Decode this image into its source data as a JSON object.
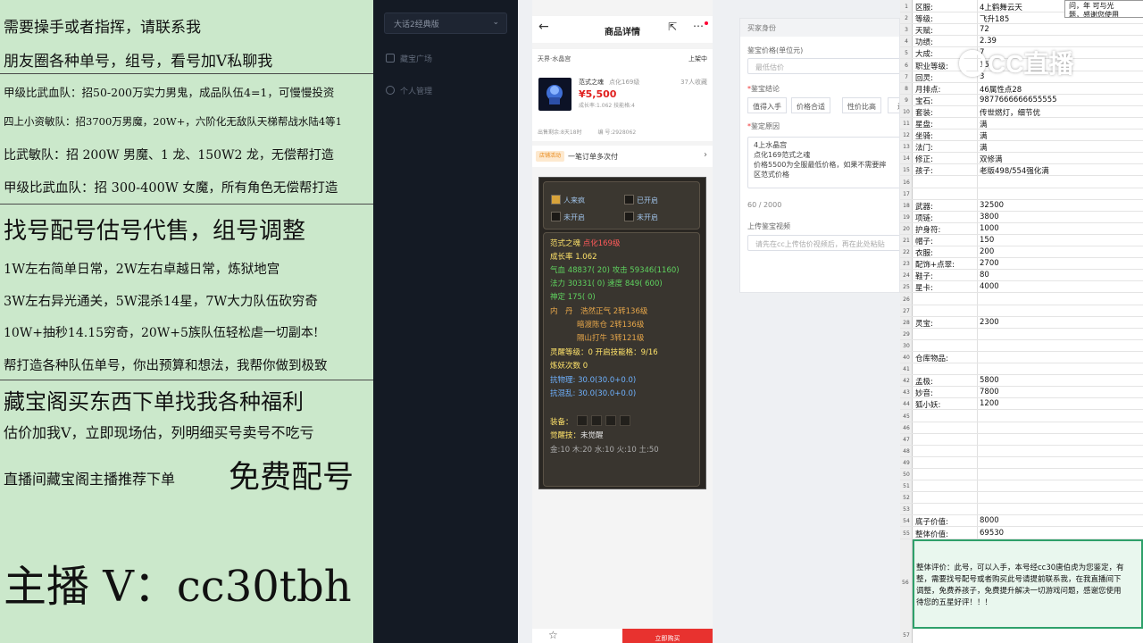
{
  "left_panel": {
    "lines": [
      "需要操手或者指挥，请联系我",
      "朋友圈各种单号，组号，看号加V私聊我",
      "甲级比武血队：招50-200万实力男鬼，成品队伍4=1，可慢慢投资",
      "四上小资敏队：招3700万男魔，20W+，六阶化无敌队天梯帮战水陆4等1",
      "比武敏队：招 200W 男魔、1 龙、150W2 龙，无偿帮打造",
      "甲级比武血队：招 300-400W 女魔，所有角色无偿帮打造",
      "找号配号估号代售，组号调整",
      "1W左右简单日常，2W左右卓越日常，炼狱地宫",
      "3W左右异光通关，5W混杀14星，7W大力队伍砍穷奇",
      "10W+抽秒14.15穷奇，20W+5族队伍轻松虐一切副本!",
      "帮打造各种队伍单号，你出预算和想法，我帮你做到极致",
      "藏宝阁买东西下单找我各种福利",
      "估价加我V，立即现场估，列明细买号卖号不吃亏",
      "直播间藏宝阁主播推荐下单",
      "免费配号",
      "主播 V：cc30tbh"
    ]
  },
  "sidebar": {
    "server_select": "大话2经典版",
    "items": [
      "藏宝广场",
      "个人管理"
    ]
  },
  "phone": {
    "header_title": "商品详情",
    "server": "天界·水晶宫",
    "status": "上架中",
    "product_name": "范式之魂",
    "product_level": "点化169级",
    "price": "¥5,500",
    "growth_line": "成长率:1.062  技能格:4",
    "favorites": "37人收藏",
    "remaining": "出售剩余:8天18时",
    "serial": "编 号:2928062",
    "promo_tag": "店铺活动",
    "promo_text": "一笔订单多次付",
    "buy_button": "立即购买",
    "game": {
      "slots": [
        "人来疯",
        "已开启",
        "未开启",
        "未开启"
      ],
      "name": "范式之魂",
      "name_level": "点化169级",
      "growth": "成长率 1.062",
      "hp": "气血 48837( 20) 攻击 59346(1160)",
      "mp": "法力 30331( 0) 速度 849( 600)",
      "focus": "神定 175( 0)",
      "inner1_label": "内　丹",
      "inner1": "浩然正气 2转136级",
      "inner2": "暗渡陈仓 2转136级",
      "inner3": "隔山打牛 3转121级",
      "spirit": "灵醒等级：0 开启技能格：9/16",
      "refine": "炼妖次数 0",
      "res1": "抗物理: 30.0(30.0+0.0)",
      "res2": "抗混乱: 30.0(30.0+0.0)",
      "equip_label": "装备：",
      "awake_label": "觉醒技：",
      "awake_value": "未觉醒",
      "elements": "金:10 木:20 水:10 火:10 土:50"
    }
  },
  "form": {
    "role_label": "买家身份",
    "appraise_price_label": "鉴宝价格(单位元)",
    "appraise_price_placeholder": "最低估价",
    "conclusion_label": "鉴宝结论",
    "conclusion_options": [
      "值得入手",
      "价格合适",
      "性价比高",
      "近"
    ],
    "reason_label": "鉴定原因",
    "reason_text": "4上水晶宫\n点化169范式之魂\n价格5500为全服最低价格，如果不需要摔\n区范式价格",
    "count": "60 / 2000",
    "video_label": "上传鉴宝视频",
    "video_placeholder": "请先在cc上传估价视频后，再在此处粘贴"
  },
  "sheet": {
    "rows": [
      {
        "n": "1",
        "k": "区服:",
        "v": "4上鹤舞云天"
      },
      {
        "n": "2",
        "k": "等级:",
        "v": "飞升185"
      },
      {
        "n": "3",
        "k": "天赋:",
        "v": "72"
      },
      {
        "n": "4",
        "k": "功绩:",
        "v": "2.39"
      },
      {
        "n": "5",
        "k": "大成:",
        "v": "7"
      },
      {
        "n": "6",
        "k": "职业等级:",
        "v": "15"
      },
      {
        "n": "7",
        "k": "回灵:",
        "v": "3"
      },
      {
        "n": "8",
        "k": "月排点:",
        "v": "46属性点28"
      },
      {
        "n": "9",
        "k": "宝石:",
        "v": "9877666666655555"
      },
      {
        "n": "10",
        "k": "套装:",
        "v": "传世燃灯，细节优"
      },
      {
        "n": "11",
        "k": "星盘:",
        "v": "满"
      },
      {
        "n": "12",
        "k": "坐骑:",
        "v": "满"
      },
      {
        "n": "13",
        "k": "法门:",
        "v": "满"
      },
      {
        "n": "14",
        "k": "修正:",
        "v": "双修满"
      },
      {
        "n": "15",
        "k": "孩子:",
        "v": "老版498/554强化满"
      },
      {
        "n": "16",
        "k": "",
        "v": ""
      },
      {
        "n": "17",
        "k": "",
        "v": ""
      },
      {
        "n": "18",
        "k": "武器:",
        "v": "32500"
      },
      {
        "n": "19",
        "k": "项链:",
        "v": "3800"
      },
      {
        "n": "20",
        "k": "护身符:",
        "v": "1000"
      },
      {
        "n": "21",
        "k": "帽子:",
        "v": "150"
      },
      {
        "n": "22",
        "k": "衣服:",
        "v": "200"
      },
      {
        "n": "23",
        "k": "配饰+点翠:",
        "v": "2700"
      },
      {
        "n": "24",
        "k": "鞋子:",
        "v": "80"
      },
      {
        "n": "25",
        "k": "星卡:",
        "v": "4000"
      },
      {
        "n": "26",
        "k": "",
        "v": ""
      },
      {
        "n": "27",
        "k": "",
        "v": ""
      },
      {
        "n": "28",
        "k": "灵宝:",
        "v": "2300"
      },
      {
        "n": "29",
        "k": "",
        "v": ""
      },
      {
        "n": "30",
        "k": "",
        "v": ""
      },
      {
        "n": "40",
        "k": "仓库物品:",
        "v": ""
      },
      {
        "n": "41",
        "k": "",
        "v": ""
      },
      {
        "n": "42",
        "k": "孟极:",
        "v": "5800"
      },
      {
        "n": "43",
        "k": "妙音:",
        "v": "7800"
      },
      {
        "n": "44",
        "k": "狐小妖:",
        "v": "1200"
      },
      {
        "n": "45",
        "k": "",
        "v": ""
      },
      {
        "n": "46",
        "k": "",
        "v": ""
      },
      {
        "n": "47",
        "k": "",
        "v": ""
      },
      {
        "n": "48",
        "k": "",
        "v": ""
      },
      {
        "n": "49",
        "k": "",
        "v": ""
      },
      {
        "n": "50",
        "k": "",
        "v": ""
      },
      {
        "n": "51",
        "k": "",
        "v": ""
      },
      {
        "n": "52",
        "k": "",
        "v": ""
      },
      {
        "n": "53",
        "k": "",
        "v": ""
      },
      {
        "n": "54",
        "k": "底子价值:",
        "v": "8000"
      },
      {
        "n": "55",
        "k": "整体价值:",
        "v": "69530"
      }
    ],
    "summary_row": "56",
    "summary_lines": [
      "整体评价：此号，可以入手，本号经cc30唐伯虎为您鉴定，有",
      "整，需要找号配号或者购买此号请提前联系我，在我直播间下",
      "调整，免费养孩子，免费提升解决一切游戏问题，感谢您使用",
      "待您的五星好评！！！"
    ],
    "last_row": "57",
    "note_lines": [
      "问，年 可与光",
      "题，感谢您使用"
    ],
    "watermark": "CC直播"
  }
}
